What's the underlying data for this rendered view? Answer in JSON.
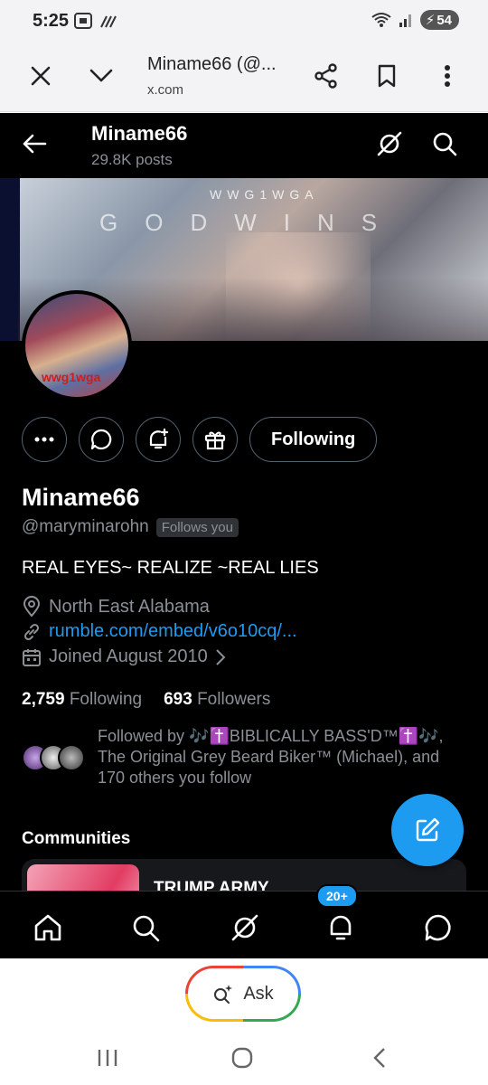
{
  "status_bar": {
    "time": "5:25",
    "battery": "54"
  },
  "custom_tab": {
    "title": "Miname66 (@...",
    "url": "x.com"
  },
  "profile": {
    "header_name": "Miname66",
    "header_posts": "29.8K posts",
    "banner_text_top": "WWG1WGA",
    "banner_text_main": "GODWINS",
    "avatar_text": "wwg1wga",
    "follow_button": "Following",
    "display_name": "Miname66",
    "handle": "@maryminarohn",
    "follows_you": "Follows you",
    "bio": "REAL EYES~ REALIZE ~REAL LIES",
    "location": "North East Alabama",
    "link": "rumble.com/embed/v6o10cq/...",
    "joined": "Joined August 2010",
    "following_count": "2,759",
    "following_label": "Following",
    "followers_count": "693",
    "followers_label": "Followers",
    "followed_by": "Followed by 🎶✝️BIBLICALLY BASS'D™✝️🎶, The Original Grey Beard Biker™ (Michael), and 170 others you follow",
    "communities_title": "Communities",
    "community_name": "TRUMP ARMY"
  },
  "bottom_nav": {
    "notifications_badge": "20+"
  },
  "system": {
    "ask_label": "Ask"
  },
  "colors": {
    "accent": "#1d9bf0",
    "background": "#000000",
    "muted": "#8b9096"
  }
}
